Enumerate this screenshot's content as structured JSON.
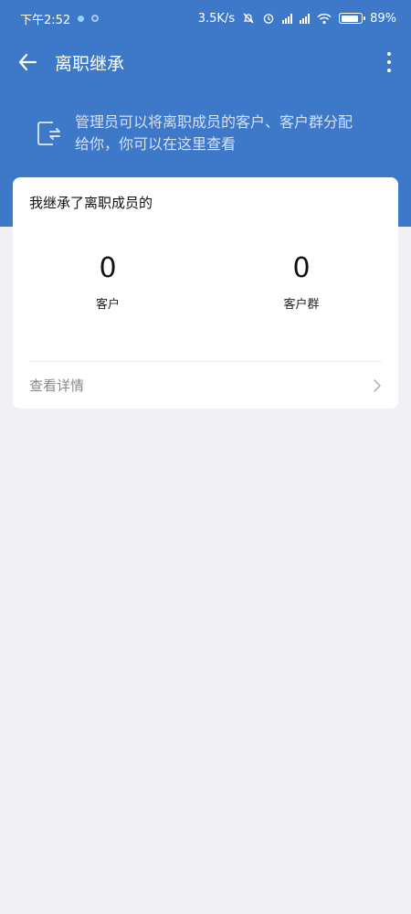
{
  "status_bar": {
    "time": "下午2:52",
    "net_speed": "3.5K/s",
    "battery_level": 0.89,
    "battery_text": "89%"
  },
  "app_bar": {
    "title": "离职继承",
    "back_icon": "arrow-left-icon",
    "more_icon": "more-vertical-icon"
  },
  "info": {
    "icon": "transfer-exit-icon",
    "line1": "管理员可以将离职成员的客户、客户群分配",
    "line2": "给你，你可以在这里查看"
  },
  "card": {
    "title": "我继承了离职成员的",
    "stats": [
      {
        "value": "0",
        "label": "客户"
      },
      {
        "value": "0",
        "label": "客户群"
      }
    ],
    "detail_label": "查看详情",
    "detail_icon": "chevron-right-icon"
  },
  "colors": {
    "header_blue": "#3e78c8",
    "page_bg": "#f1f1f5",
    "card_bg": "#ffffff"
  }
}
